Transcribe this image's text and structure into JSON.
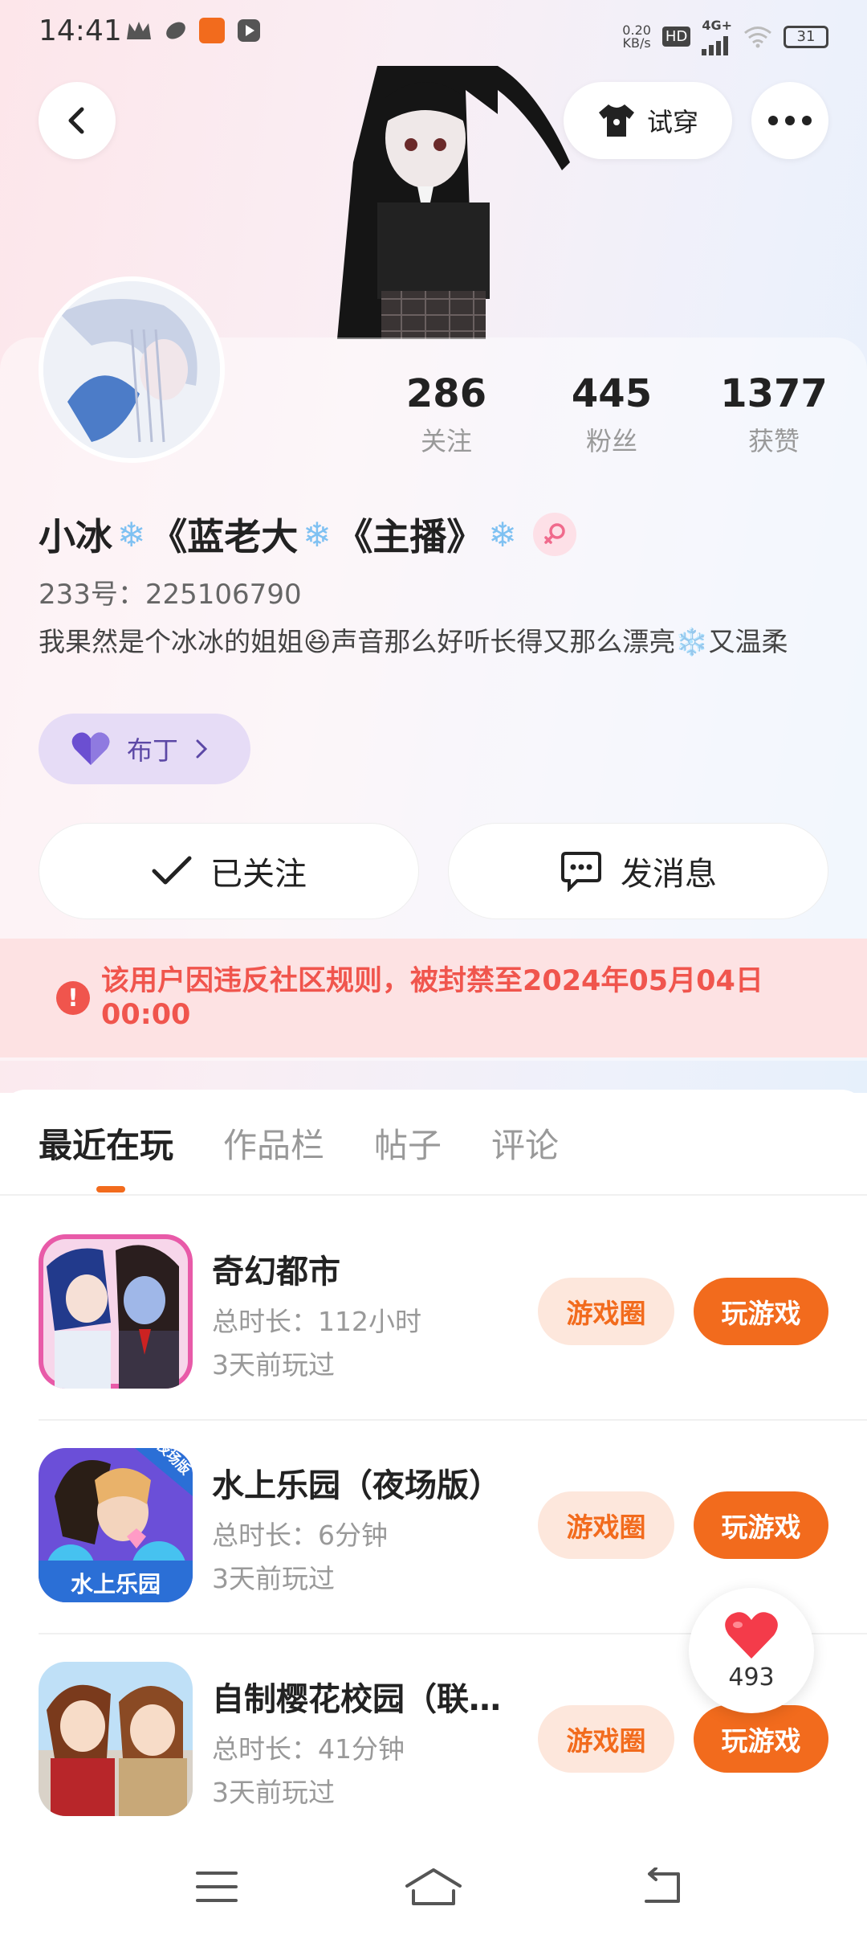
{
  "status_bar": {
    "time": "14:41",
    "net_speed_value": "0.20",
    "net_speed_unit": "KB/s",
    "hd_badge": "HD",
    "network": "4G+",
    "battery": "31"
  },
  "header": {
    "tryon_label": "试穿"
  },
  "profile": {
    "following_count": "286",
    "following_label": "关注",
    "followers_count": "445",
    "followers_label": "粉丝",
    "likes_count": "1377",
    "likes_label": "获赞",
    "nickname_part1": "小冰",
    "nickname_part2": "《蓝老大",
    "nickname_part3": "《主播》",
    "uid": "233号：225106790",
    "bio": "我果然是个冰冰的姐姐😆声音那么好听长得又那么漂亮❄️又温柔",
    "pudding_label": "布丁",
    "followed_label": "已关注",
    "message_label": "发消息"
  },
  "ban_notice": "该用户因违反社区规则，被封禁至2024年05月04日 00:00",
  "tabs": [
    "最近在玩",
    "作品栏",
    "帖子",
    "评论"
  ],
  "games": [
    {
      "title": "奇幻都市",
      "duration": "总时长：112小时",
      "last_played": "3天前玩过",
      "circle_label": "游戏圈",
      "play_label": "玩游戏"
    },
    {
      "title": "水上乐园（夜场版）",
      "duration": "总时长：6分钟",
      "last_played": "3天前玩过",
      "circle_label": "游戏圈",
      "play_label": "玩游戏",
      "icon_tag": "夜场版",
      "icon_text": "水上乐园"
    },
    {
      "title": "自制樱花校园（联…",
      "duration": "总时长：41分钟",
      "last_played": "3天前玩过",
      "circle_label": "游戏圈",
      "play_label": "玩游戏"
    }
  ],
  "like_float": {
    "count": "493"
  },
  "colors": {
    "accent": "#f26b1d",
    "ban_text": "#f0554d",
    "ban_bg": "#fde2e3",
    "pudding_bg": "#e6dcf6"
  }
}
